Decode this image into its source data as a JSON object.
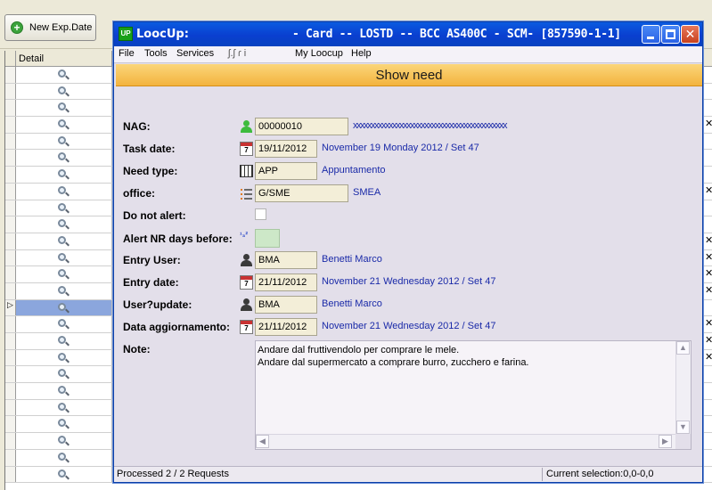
{
  "background": {
    "toolbar": {
      "new_exp_label": "New Exp.Date"
    },
    "grid": {
      "detail_header": "Detail",
      "row_count": 25,
      "selected_index": 14,
      "current_row_marker": "▷"
    }
  },
  "dialog": {
    "app_name": "LoocUp:",
    "app_icon_text": "UP",
    "title": "- Card -- LOSTD -- BCC AS400C - SCM- [857590-1-1]",
    "menu": [
      "File",
      "Tools",
      "Services",
      "ʃ.ʃ  ɾ  i",
      "My Loocup",
      "Help"
    ],
    "banner": "Show need",
    "fields": {
      "nag": {
        "label": "NAG:",
        "value": "00000010",
        "desc": "xxxxxxxxxxxxxxxxxxxxxxxxxxxxxxxxxxxxxxxxxxx"
      },
      "task_date": {
        "label": "Task date:",
        "value": "19/11/2012",
        "desc": "November 19 Monday 2012 / Set 47",
        "icon_text": "7"
      },
      "need_type": {
        "label": "Need type:",
        "value": "APP",
        "desc": "Appuntamento"
      },
      "office": {
        "label": "office:",
        "value": "G/SME",
        "desc": "SMEA"
      },
      "do_not_alert": {
        "label": "Do not alert:"
      },
      "alert_days": {
        "label": "Alert NR days before:",
        "icon_text": "¹₃²"
      },
      "entry_user": {
        "label": "Entry User:",
        "value": "BMA",
        "desc": "Benetti Marco"
      },
      "entry_date": {
        "label": "Entry date:",
        "value": "21/11/2012",
        "desc": "November 21 Wednesday 2012 / Set 47",
        "icon_text": "7"
      },
      "update_user": {
        "label": "User?update:",
        "value": "BMA",
        "desc": "Benetti Marco"
      },
      "update_date": {
        "label": "Data aggiornamento:",
        "value": "21/11/2012",
        "desc": "November 21 Wednesday 2012 / Set 47",
        "icon_text": "7"
      },
      "note": {
        "label": "Note:",
        "lines": [
          "Andare dal fruttivendolo per comprare le mele.",
          "Andare dal supermercato a comprare burro, zucchero e farina."
        ]
      }
    },
    "status": {
      "left": "Processed 2 / 2 Requests",
      "right": "Current selection:0,0-0,0"
    }
  }
}
